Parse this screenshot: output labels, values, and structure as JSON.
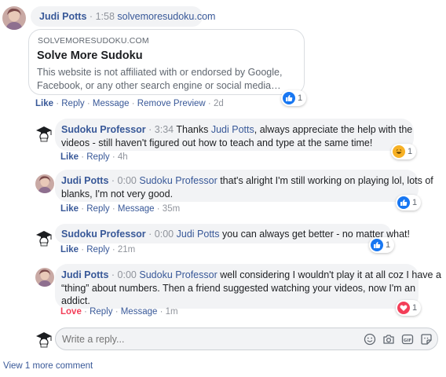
{
  "post": {
    "author": "Judi Potts",
    "meta_sep": "·",
    "time": "1:58",
    "url_text": "solvemoresudoku.com",
    "preview": {
      "domain": "SOLVEMORESUDOKU.COM",
      "title": "Solve More Sudoku",
      "description_line1": "This website is not affiliated with or endorsed by Google,",
      "description_line2": "Facebook, or any other search engine or social media…"
    },
    "actions": {
      "like": "Like",
      "reply": "Reply",
      "message": "Message",
      "remove_preview": "Remove Preview",
      "time": "2d"
    },
    "reaction": {
      "type": "like",
      "count": "1",
      "icon": "thumbs-up-icon"
    }
  },
  "replies": [
    {
      "author": "Sudoku Professor",
      "time": "3:34",
      "line1_pre": "Thanks ",
      "line1_mention": "Judi Potts",
      "line1_post": ", always appreciate the help with the",
      "line2": "videos - still haven't figured out how to teach and type at the same time!",
      "actions": {
        "like": "Like",
        "reply": "Reply",
        "time": "4h"
      },
      "reaction": {
        "type": "haha",
        "count": "1",
        "icon": "laughing-emoji-icon"
      }
    },
    {
      "author": "Judi Potts",
      "time": "0:00",
      "mention": "Sudoku Professor",
      "line1_post": " that's alright I'm still working on playing lol, lots of",
      "line2": "blanks, I'm not very good.",
      "actions": {
        "like": "Like",
        "reply": "Reply",
        "message": "Message",
        "time": "35m"
      },
      "reaction": {
        "type": "like",
        "count": "1",
        "icon": "thumbs-up-icon"
      }
    },
    {
      "author": "Sudoku Professor",
      "time": "0:00",
      "mention": "Judi Potts",
      "line1_post": " you can always get better - no matter what!",
      "actions": {
        "like": "Like",
        "reply": "Reply",
        "time": "21m"
      },
      "reaction": {
        "type": "like",
        "count": "1",
        "icon": "thumbs-up-icon"
      }
    },
    {
      "author": "Judi Potts",
      "time": "0:00",
      "mention": "Sudoku Professor",
      "line1_post": " well considering I wouldn't play it at all coz I have a",
      "line2": "“thing” about numbers. Then a friend suggested watching your videos, now I'm an",
      "line3": "addict.",
      "actions": {
        "love": "Love",
        "reply": "Reply",
        "message": "Message",
        "time": "1m"
      },
      "reaction": {
        "type": "love",
        "count": "1",
        "icon": "heart-icon"
      }
    }
  ],
  "composer": {
    "placeholder": "Write a reply...",
    "icons": [
      "emoji-icon",
      "camera-icon",
      "gif-icon",
      "sticker-icon"
    ]
  },
  "view_more": "View 1 more comment",
  "colors": {
    "link": "#385898",
    "bubble": "#f2f3f5",
    "muted": "#90949c",
    "like": "#1877f2",
    "love": "#f33e58",
    "haha": "#f7b125"
  }
}
